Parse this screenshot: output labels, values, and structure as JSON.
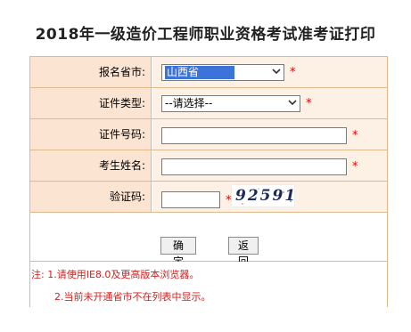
{
  "page": {
    "title": "2018年一级造价工程师职业资格考试准考证打印"
  },
  "form": {
    "province": {
      "label": "报名省市:",
      "selected": "山西省"
    },
    "id_type": {
      "label": "证件类型:",
      "selected": "--请选择--"
    },
    "id_number": {
      "label": "证件号码:",
      "value": ""
    },
    "name": {
      "label": "考生姓名:",
      "value": ""
    },
    "captcha": {
      "label": "验证码:",
      "value": "",
      "image_text": "92591"
    },
    "required_mark": "*"
  },
  "buttons": {
    "confirm": "确 定",
    "back": "返 回"
  },
  "notes": {
    "line1": "注: 1.请使用IE8.0及更高版本浏览器。",
    "line2": "2.当前未开通省市不在列表中显示。"
  },
  "colors": {
    "label_bg": "#fbe4d2",
    "field_bg": "#fdf1e6",
    "border": "#e0b98f",
    "required": "#e00000",
    "note_text": "#cc2222",
    "selected_highlight": "#3b73d8"
  }
}
